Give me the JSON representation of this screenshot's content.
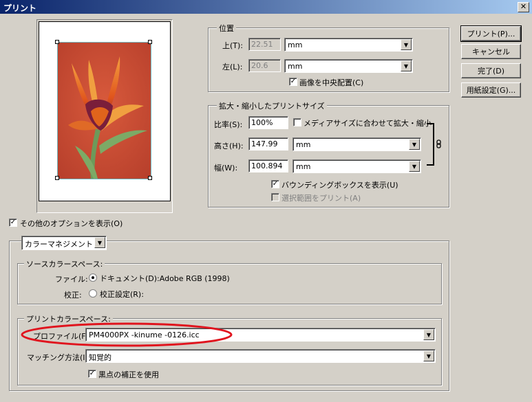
{
  "window": {
    "title": "プリント",
    "close_glyph": "✕"
  },
  "buttons": {
    "print": "プリント(P)...",
    "cancel": "キャンセル",
    "done": "完了(D)",
    "page_setup": "用紙設定(G)..."
  },
  "position": {
    "group_label": "位置",
    "top_label": "上(T):",
    "top_value": "22.51",
    "top_unit": "mm",
    "left_label": "左(L):",
    "left_value": "20.6",
    "left_unit": "mm",
    "center_label": "画像を中央配置(C)",
    "center_checked": true
  },
  "scaled": {
    "group_label": "拡大・縮小したプリントサイズ",
    "scale_label": "比率(S):",
    "scale_value": "100%",
    "fit_media_label": "メディアサイズに合わせて拡大・縮小",
    "fit_media_checked": false,
    "height_label": "高さ(H):",
    "height_value": "147.99",
    "height_unit": "mm",
    "width_label": "幅(W):",
    "width_value": "100.894",
    "width_unit": "mm",
    "bbox_label": "バウンディングボックスを表示(U)",
    "bbox_checked": true,
    "print_selection_label": "選択範囲をプリント(A)",
    "print_selection_checked": false
  },
  "more_options": {
    "label": "その他のオプションを表示(O)",
    "checked": true
  },
  "color": {
    "mode_select": "カラーマネジメント",
    "source_group_label": "ソースカラースペース:",
    "file_label": "ファイル:",
    "document_label": "ドキュメント(D):Adobe RGB (1998)",
    "document_selected": true,
    "proof_label": "校正:",
    "proof_setup_label": "校正設定(R):",
    "proof_selected": false,
    "print_group_label": "プリントカラースペース:",
    "profile_label": "プロファイル(F):",
    "profile_value": "PM4000PX -kinume -0126.icc",
    "intent_label": "マッチング方法(I):",
    "intent_value": "知覚的",
    "bpc_label": "黒点の補正を使用",
    "bpc_checked": true
  },
  "colors": {
    "annotation": "#e0141e",
    "title_bar": "#0a246a",
    "dialog_bg": "#d4d0c8"
  }
}
